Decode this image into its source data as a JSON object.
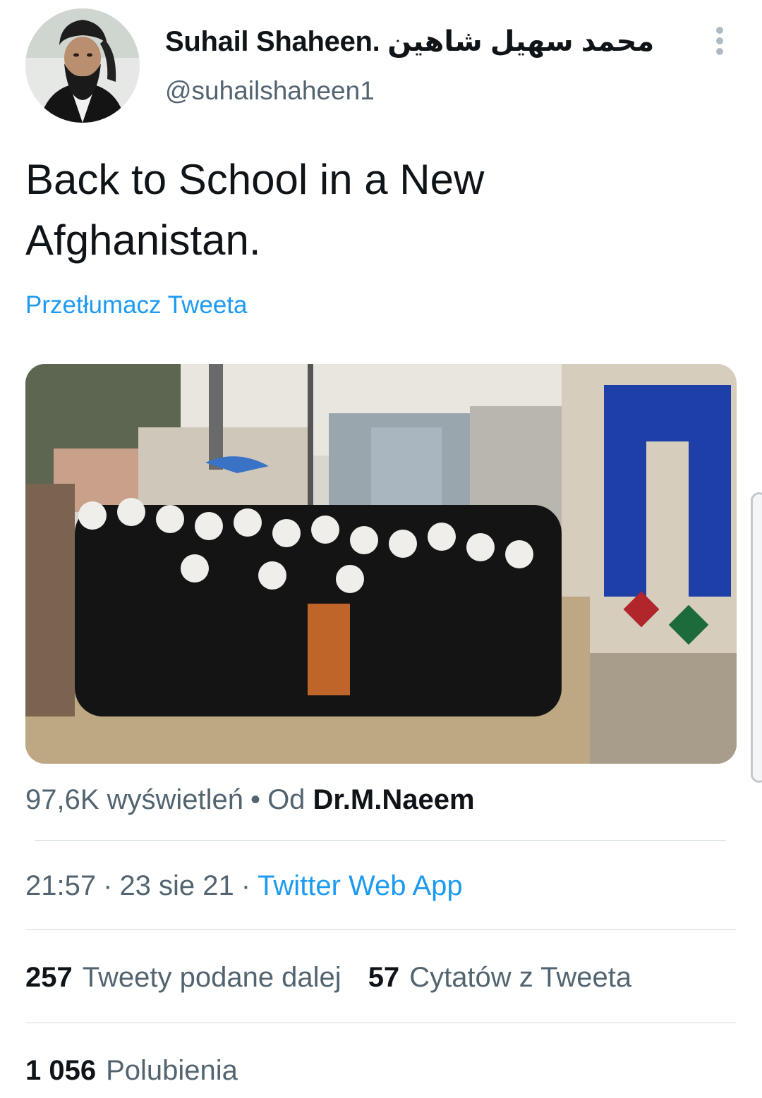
{
  "tweet": {
    "author": {
      "display_name": "Suhail Shaheen. محمد سهیل شاهین",
      "handle": "@suhailshaheen1",
      "avatar_icon": "profile-photo"
    },
    "more_icon": "more-vertical-icon",
    "text": "Back to School in a New Afghanistan.",
    "translate_label": "Przetłumacz Tweeta",
    "media": {
      "type": "video-still",
      "scene": "video still"
    },
    "views": {
      "count_label": "97,6K wyświetleń",
      "separator": "•",
      "from_label": "Od",
      "from_author": "Dr.M.Naeem"
    },
    "meta": {
      "time": "21:57",
      "date": "23 sie 21",
      "separator": "·",
      "source": "Twitter Web App"
    },
    "stats": {
      "retweets_count": "257",
      "retweets_label": "Tweety podane dalej",
      "quotes_count": "57",
      "quotes_label": "Cytatów z Tweeta",
      "likes_count": "1 056",
      "likes_label": "Polubienia"
    }
  },
  "colors": {
    "text_primary": "#0f1419",
    "text_secondary": "#536471",
    "link": "#1d9bf0",
    "divider": "#cfd9de"
  }
}
